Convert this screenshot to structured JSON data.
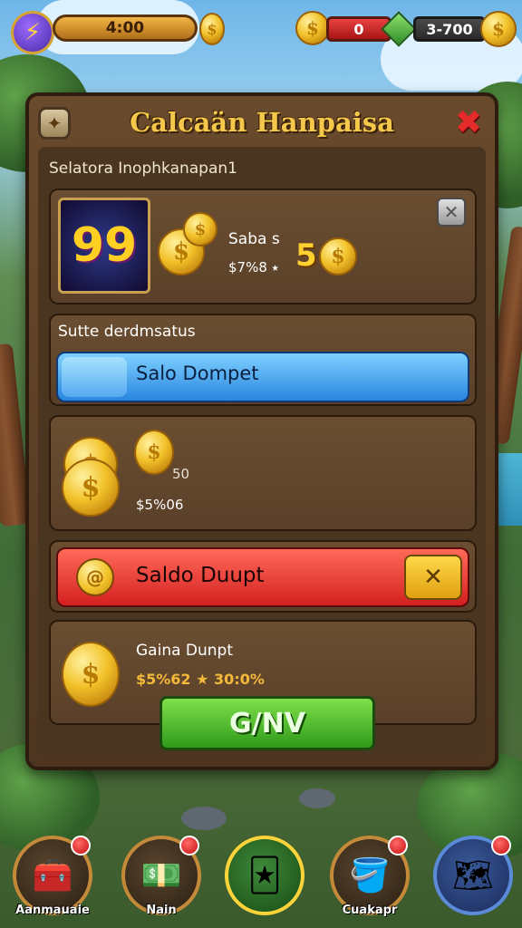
{
  "hud": {
    "energy_value": "4:00",
    "red_counter": "0",
    "coin_counter": "3-700"
  },
  "dialog": {
    "title": "Calcaän Hanpaisa",
    "subtitle": "Selatora Inophkanapan1",
    "item": {
      "name": "Saba s",
      "price": "$7%8 ⭑",
      "amount": "5",
      "thumb_text": "99"
    },
    "section_label": "Sutte derdmsatus",
    "blue_bar_label": "Salo Dompet",
    "coins_row": {
      "amount": "50",
      "value": "$5%06"
    },
    "red_bar_label": "Saldo Duupt",
    "gain": {
      "label": "Gaina Dunpt",
      "value": "$5%62 ★ 30:0%"
    },
    "confirm_label": "G/NV"
  },
  "nav": {
    "items": [
      {
        "label": "Aanmauaie"
      },
      {
        "label": "Nain"
      },
      {
        "label": ""
      },
      {
        "label": "Cuakapr"
      },
      {
        "label": ""
      }
    ]
  }
}
